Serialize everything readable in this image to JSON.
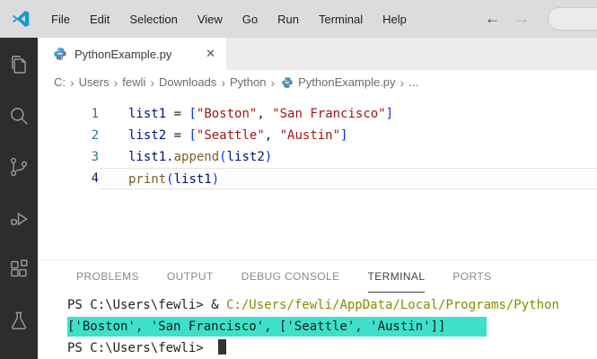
{
  "titlebar": {
    "menus": [
      "File",
      "Edit",
      "Selection",
      "View",
      "Go",
      "Run",
      "Terminal",
      "Help"
    ]
  },
  "icons": {
    "back_arrow": "←",
    "forward_arrow": "→",
    "tab_close": "✕",
    "breadcrumb_separator": "›"
  },
  "tab": {
    "file_label": "PythonExample.py"
  },
  "breadcrumb": {
    "segments": [
      "C:",
      "Users",
      "fewli",
      "Downloads",
      "Python"
    ],
    "file": "PythonExample.py",
    "overflow": "..."
  },
  "editor": {
    "lines": [
      {
        "num": "1",
        "segs": [
          "list1",
          " = ",
          "[",
          "\"Boston\"",
          ", ",
          "\"San Francisco\"",
          "]"
        ]
      },
      {
        "num": "2",
        "segs": [
          "list2",
          " = ",
          "[",
          "\"Seattle\"",
          ", ",
          "\"Austin\"",
          "]"
        ]
      },
      {
        "num": "3",
        "segs": [
          "list1",
          ".",
          "append",
          "(",
          "list2",
          ")"
        ]
      },
      {
        "num": "4",
        "segs": [
          "print",
          "(",
          "list1",
          ")"
        ]
      }
    ]
  },
  "panel": {
    "tabs": [
      "PROBLEMS",
      "OUTPUT",
      "DEBUG CONSOLE",
      "TERMINAL",
      "PORTS"
    ],
    "active_tab": "TERMINAL"
  },
  "terminal": {
    "prompt": "PS C:\\Users\\fewli> ",
    "ampersand": "& ",
    "command": "C:/Users/fewli/AppData/Local/Programs/Python",
    "output": "['Boston', 'San Francisco', ['Seattle', 'Austin']]"
  },
  "colors": {
    "titlebar_bg": "#dcdcdc",
    "activitybar_bg": "#2d2d2d",
    "tabbar_bg": "#ececec",
    "selection_highlight": "#3ee0c9",
    "command_color": "#8a8a00",
    "string_color": "#a31515",
    "variable_color": "#001080",
    "function_color": "#795e26",
    "bracket_color": "#0431fa",
    "line_number_color": "#237893",
    "run_dot_color": "#1e7ad6"
  }
}
